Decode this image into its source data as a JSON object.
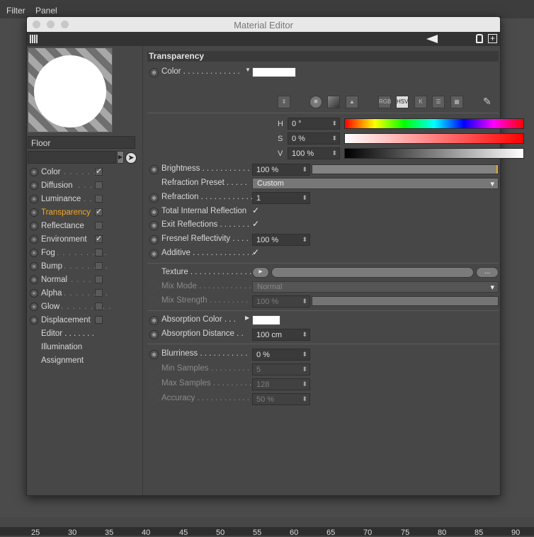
{
  "menubar": {
    "items": [
      "Filter",
      "Panel"
    ]
  },
  "ruler": {
    "ticks": [
      "25",
      "30",
      "35",
      "40",
      "45",
      "50",
      "55",
      "60",
      "65",
      "70",
      "75",
      "80",
      "85",
      "90"
    ]
  },
  "window": {
    "title": "Material Editor"
  },
  "material": {
    "name": "Floor"
  },
  "channels": [
    {
      "label": "Color",
      "checked": true,
      "dots": ". . . . . . ."
    },
    {
      "label": "Diffusion",
      "checked": false,
      "dots": ". . . ."
    },
    {
      "label": "Luminance",
      "checked": false,
      "dots": ". . ."
    },
    {
      "label": "Transparency",
      "checked": true,
      "active": true,
      "dots": ""
    },
    {
      "label": "Reflectance",
      "checked": false,
      "dots": ""
    },
    {
      "label": "Environment",
      "checked": true,
      "dots": ""
    },
    {
      "label": "Fog",
      "checked": false,
      "dots": ". . . . . . . . ."
    },
    {
      "label": "Bump",
      "checked": false,
      "dots": ". . . . . . . ."
    },
    {
      "label": "Normal",
      "checked": false,
      "dots": ". . . . . ."
    },
    {
      "label": "Alpha",
      "checked": false,
      "dots": ". . . . . . . ."
    },
    {
      "label": "Glow",
      "checked": false,
      "dots": ". . . . . . . . ."
    },
    {
      "label": "Displacement",
      "checked": false,
      "dots": ""
    }
  ],
  "extra_items": [
    "Editor . . . . . . .",
    "Illumination",
    "Assignment"
  ],
  "section": {
    "title": "Transparency"
  },
  "color": {
    "label": "Color . . . . . . . . . . . . .",
    "swatch": "#ffffff",
    "modes": [
      "RGB",
      "HSV",
      "K"
    ],
    "h_label": "H",
    "h_value": "0 °",
    "s_label": "S",
    "s_value": "0 %",
    "v_label": "V",
    "v_value": "100 %"
  },
  "brightness": {
    "label": "Brightness . . . . . . . . . . .",
    "value": "100 %",
    "level": 1.0
  },
  "refraction_preset": {
    "label": "Refraction Preset . . . . .",
    "value": "Custom"
  },
  "refraction": {
    "label": "Refraction . . . . . . . . . . . .",
    "value": "1"
  },
  "total_internal": {
    "label": "Total Internal Reflection",
    "checked": true
  },
  "exit_reflections": {
    "label": "Exit Reflections . . . . . . .",
    "checked": true
  },
  "fresnel": {
    "label": "Fresnel Reflectivity . . . .",
    "value": "100 %"
  },
  "additive": {
    "label": "Additive . . . . . . . . . . . . . .",
    "checked": true
  },
  "texture": {
    "label": "Texture . . . . . . . . . . . . . . .",
    "more": "..."
  },
  "mix_mode": {
    "label": "Mix Mode . . . . . . . . . . . .",
    "value": "Normal"
  },
  "mix_strength": {
    "label": "Mix Strength . . . . . . . . .",
    "value": "100 %",
    "level": 1.0
  },
  "absorption_color": {
    "label": "Absorption Color . . .",
    "swatch": "#ffffff"
  },
  "absorption_distance": {
    "label": "Absorption Distance . .",
    "value": "100 cm"
  },
  "blurriness": {
    "label": "Blurriness . . . . . . . . . . .",
    "value": "0 %"
  },
  "min_samples": {
    "label": "Min Samples . . . . . . . . .",
    "value": "5"
  },
  "max_samples": {
    "label": "Max Samples . . . . . . . . .",
    "value": "128"
  },
  "accuracy": {
    "label": "Accuracy . . . . . . . . . . . . .",
    "value": "50 %"
  }
}
